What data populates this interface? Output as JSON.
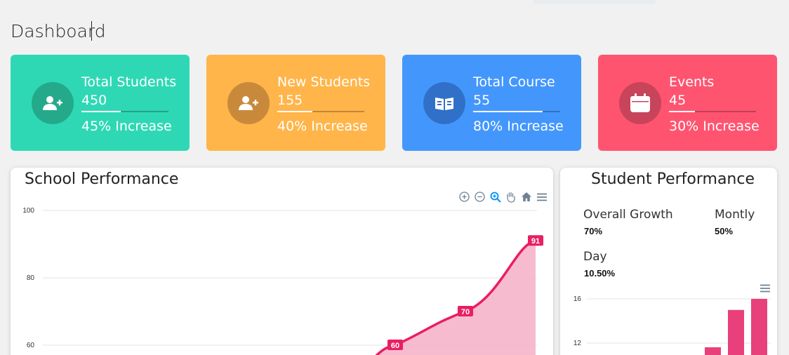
{
  "page": {
    "title": "Dashboard"
  },
  "cards": [
    {
      "title": "Total Students",
      "value": "450",
      "footer": "45% Increase",
      "progress": 0.45,
      "icon": "user-plus-icon",
      "bg": "#2fd8b5",
      "icon_bg": "#25a98b"
    },
    {
      "title": "New Students",
      "value": "155",
      "footer": "40% Increase",
      "progress": 0.4,
      "icon": "user-plus-icon",
      "bg": "#ffb54a",
      "icon_bg": "#c88a3a"
    },
    {
      "title": "Total Course",
      "value": "55",
      "footer": "80% Increase",
      "progress": 0.8,
      "icon": "book-open-icon",
      "bg": "#4397fc",
      "icon_bg": "#3170c8"
    },
    {
      "title": "Events",
      "value": "45",
      "footer": "30% Increase",
      "progress": 0.3,
      "icon": "calendar-icon",
      "bg": "#ff5470",
      "icon_bg": "#c7445a"
    }
  ],
  "school_performance": {
    "title": "School Performance",
    "toolbar": [
      "zoom-in-icon",
      "zoom-out-icon",
      "zoom-select-icon",
      "pan-hand-icon",
      "home-icon",
      "menu-icon"
    ],
    "chart_data": {
      "type": "area",
      "y_ticks": [
        "100",
        "80",
        "60"
      ],
      "ylim": [
        60,
        100
      ],
      "points": [
        {
          "label": "60",
          "value": 60
        },
        {
          "label": "70",
          "value": 70
        },
        {
          "label": "91",
          "value": 91
        }
      ],
      "color": "#e91e63",
      "fill": "#f7b7cc"
    }
  },
  "student_performance": {
    "title": "Student Performance",
    "stats": [
      {
        "label": "Overall Growth",
        "value": "70%"
      },
      {
        "label": "Montly",
        "value": "50%"
      },
      {
        "label": "Day",
        "value": "10.50%"
      }
    ],
    "menu_icon": "menu-icon",
    "chart_data": {
      "type": "bar",
      "y_ticks": [
        "16",
        "12"
      ],
      "ylim": [
        12,
        16
      ],
      "values": [
        12,
        15,
        16
      ],
      "color": "#e8407a"
    }
  }
}
